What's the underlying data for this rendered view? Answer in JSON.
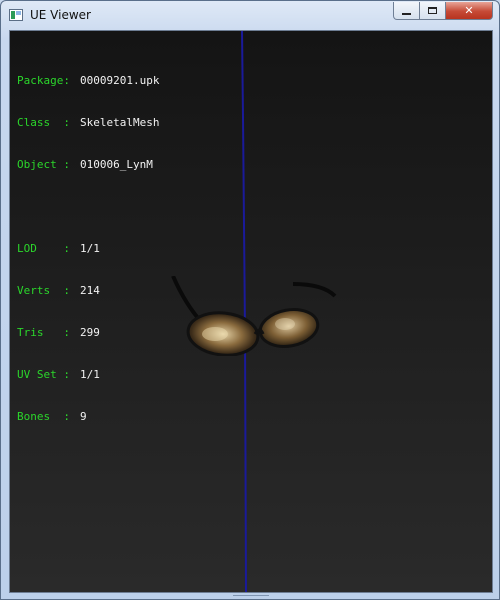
{
  "window": {
    "title": "UE Viewer",
    "minimize": "minimize",
    "maximize": "maximize",
    "close": "close"
  },
  "info": {
    "package": {
      "key": "Package:",
      "value": "00009201.upk"
    },
    "class": {
      "key": "Class  :",
      "value": "SkeletalMesh"
    },
    "object": {
      "key": "Object :",
      "value": "010006_LynM"
    },
    "lod": {
      "key": "LOD    :",
      "value": "1/1"
    },
    "verts": {
      "key": "Verts  :",
      "value": "214"
    },
    "tris": {
      "key": "Tris   :",
      "value": "299"
    },
    "uvset": {
      "key": "UV Set :",
      "value": "1/1"
    },
    "bones": {
      "key": "Bones  :",
      "value": "9"
    }
  },
  "colors": {
    "label": "#2bd62b",
    "value": "#f2f2f2",
    "axis": "#1a1a9a"
  },
  "icons": [
    "app-icon",
    "minimize-icon",
    "maximize-icon",
    "close-icon"
  ]
}
